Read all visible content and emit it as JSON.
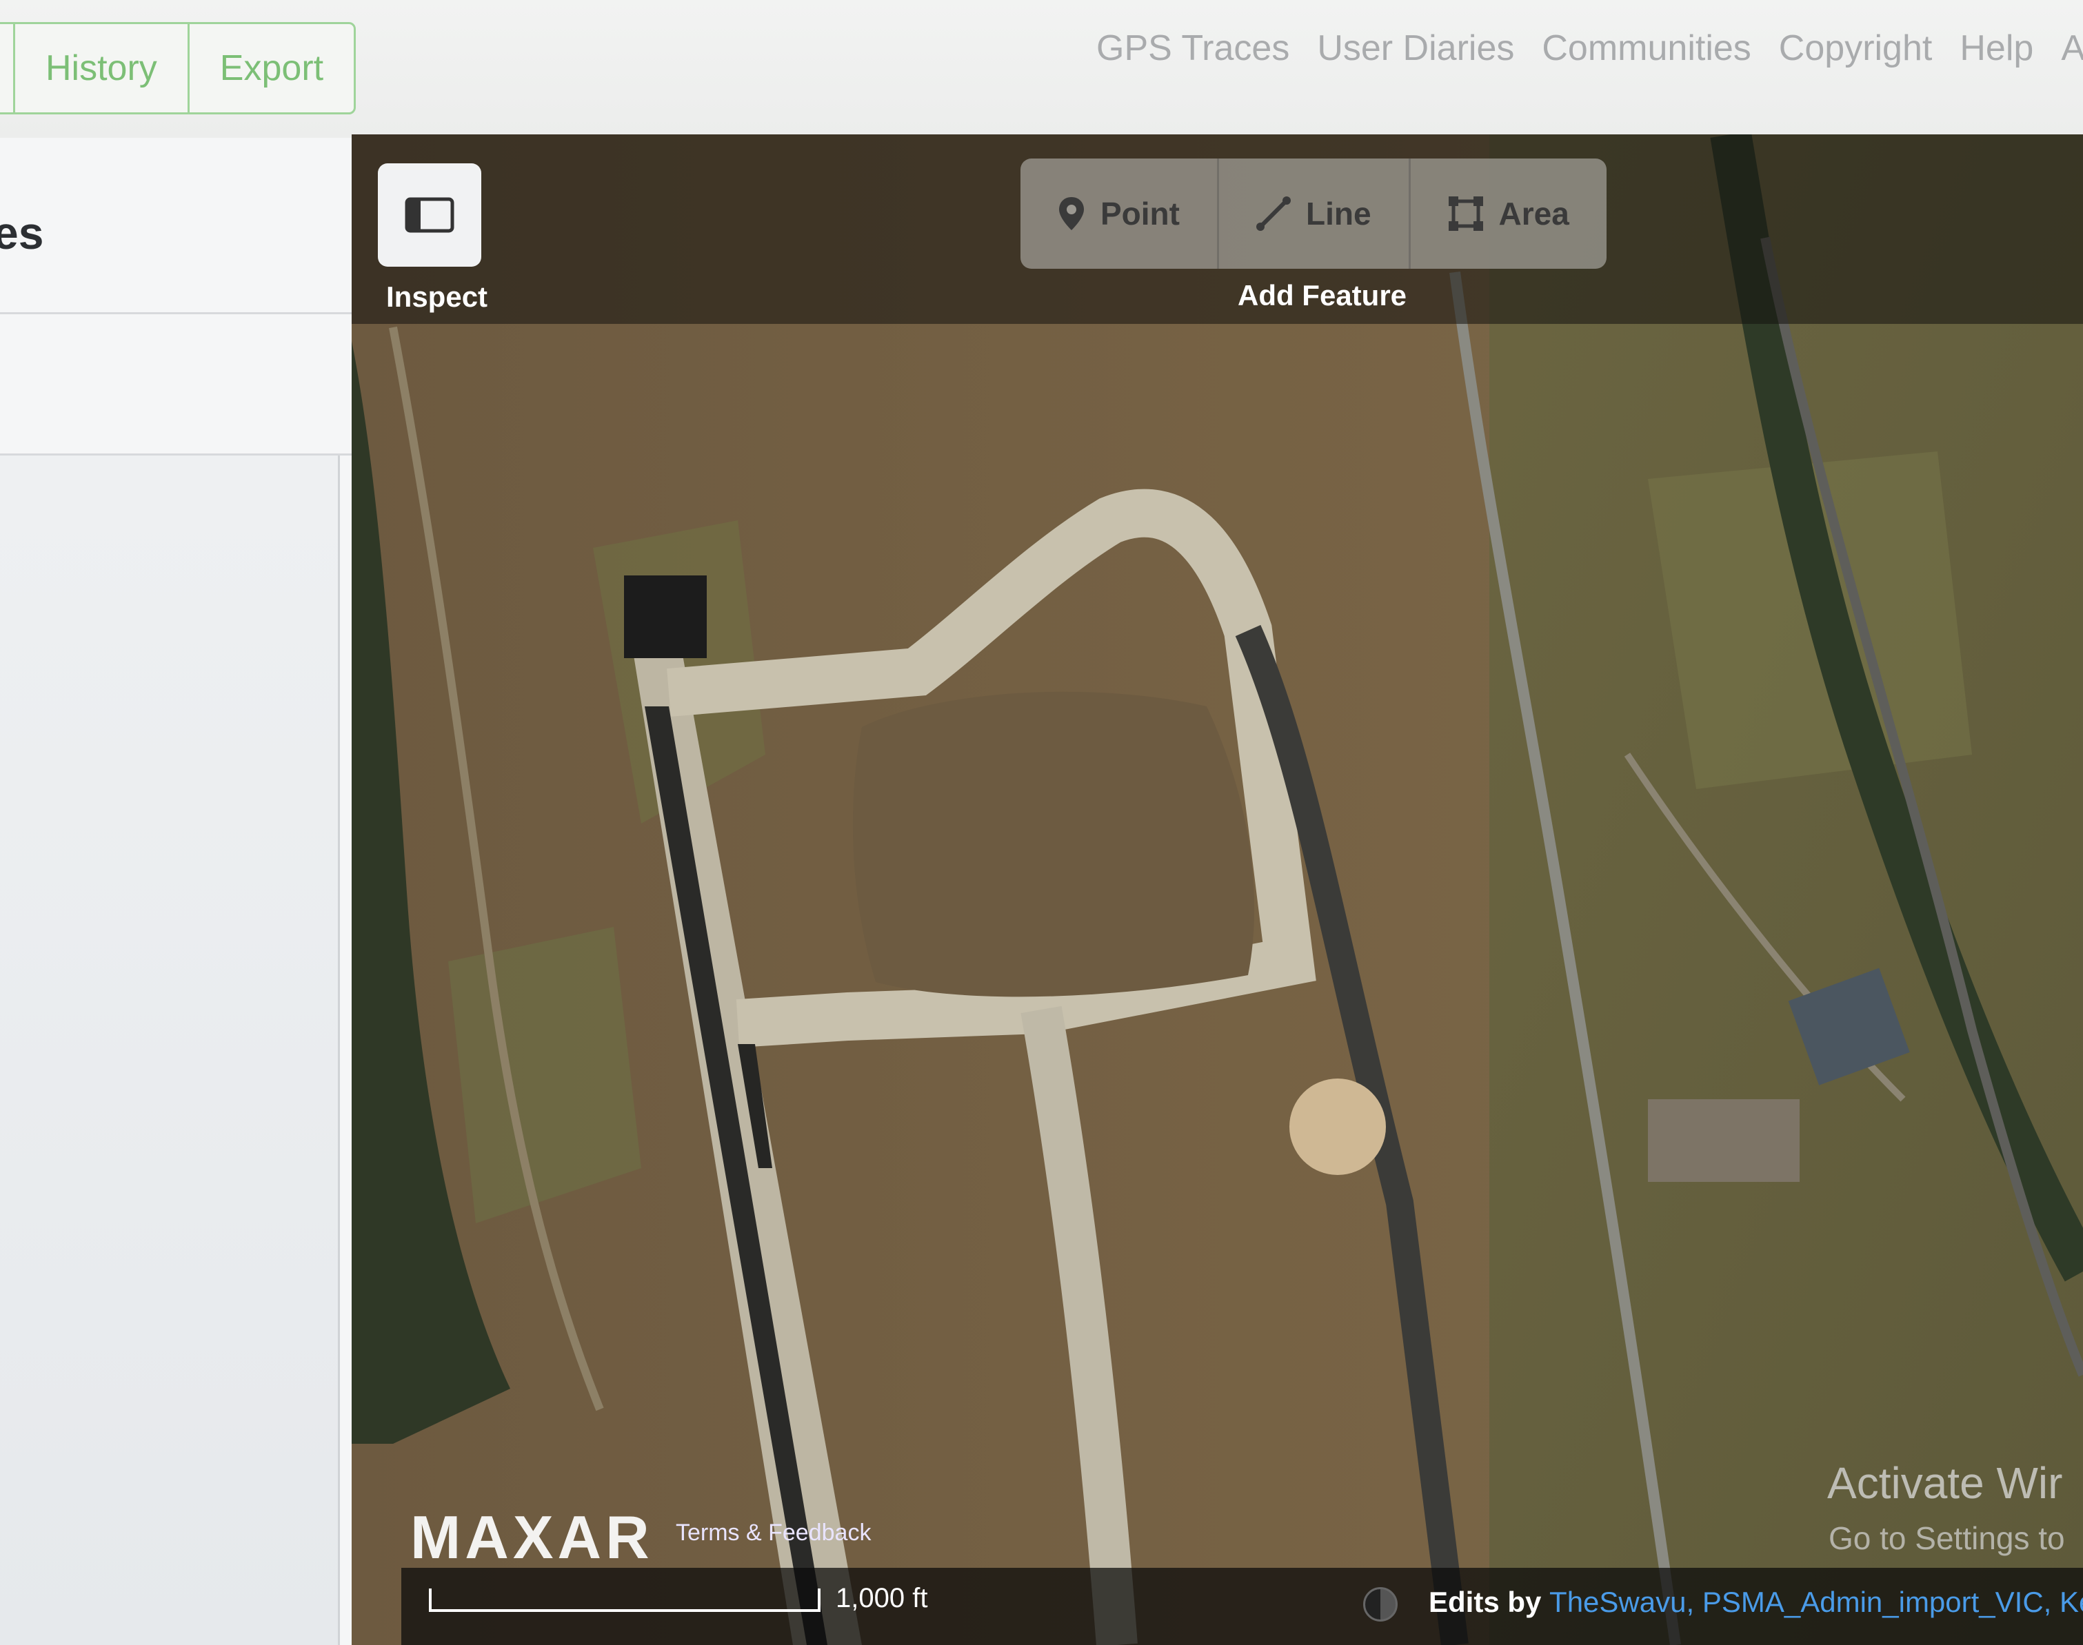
{
  "toolbar": {
    "history_label": "History",
    "export_label": "Export"
  },
  "nav": {
    "links": [
      "GPS Traces",
      "User Diaries",
      "Communities",
      "Copyright",
      "Help",
      "Abo"
    ]
  },
  "sidebar": {
    "heading": "es"
  },
  "map": {
    "inspect_label": "Inspect",
    "add_feature_label": "Add Feature",
    "point_label": "Point",
    "line_label": "Line",
    "area_label": "Area",
    "imagery_provider": "MAXAR",
    "terms_label": "Terms & Feedback",
    "scale_label": "1,000 ft",
    "edits_prefix": "Edits by",
    "edits_names": "TheSwavu, PSMA_Admin_import_VIC, KenS,"
  },
  "watermark": {
    "title": "Activate Wir",
    "subtitle": "Go to Settings to"
  },
  "colors": {
    "accent_green": "#7cbf76",
    "link_blue": "#4a9be8"
  }
}
